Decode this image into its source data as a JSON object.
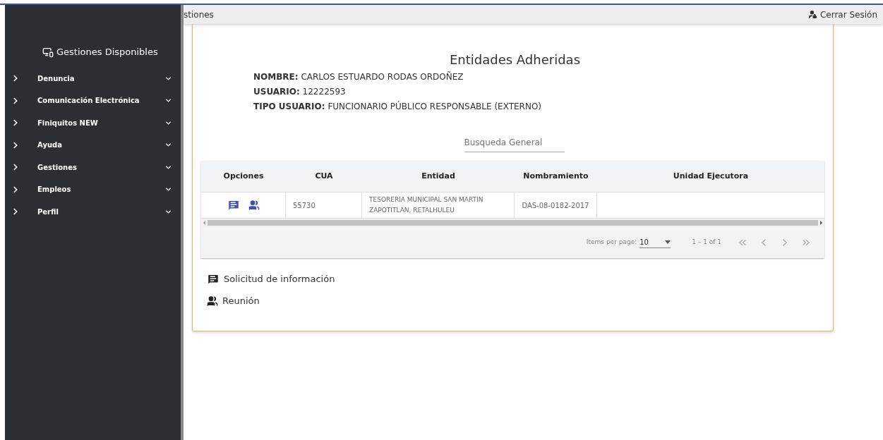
{
  "sidebar": {
    "title": "Gestiones Disponibles",
    "items": [
      {
        "label": "Denuncia",
        "expanded": false
      },
      {
        "label": "Comunicación Electrónica",
        "expanded": false
      },
      {
        "label": "Finiquitos NEW",
        "expanded": false
      },
      {
        "label": "Ayuda",
        "expanded": false
      },
      {
        "label": "Gestiones",
        "expanded": false
      },
      {
        "label": "Empleos",
        "expanded": false
      },
      {
        "label": "Perfil",
        "expanded": false
      }
    ]
  },
  "topbar": {
    "title": "stiones",
    "logout": "Cerrar Sesión"
  },
  "header": {
    "title": "Entidades Adheridas",
    "fields": [
      {
        "label": "NOMBRE:",
        "value": "CARLOS ESTUARDO RODAS ORDOÑEZ"
      },
      {
        "label": "USUARIO:",
        "value": "12222593"
      },
      {
        "label": "TIPO USUARIO:",
        "value": "FUNCIONARIO PÚBLICO RESPONSABLE (EXTERNO)"
      }
    ]
  },
  "search": {
    "placeholder": "Busqueda General"
  },
  "table": {
    "columns": [
      "Opciones",
      "CUA",
      "Entidad",
      "Nombramiento",
      "Unidad Ejecutora"
    ],
    "rows": [
      {
        "cua": "55730",
        "entidad": "TESORERIA MUNICIPAL SAN MARTIN ZAPOTITLAN, RETALHULEU",
        "nombramiento": "DAS-08-0182-2017",
        "unidad": ""
      }
    ]
  },
  "paginator": {
    "label": "Items per page:",
    "page_size": "10",
    "range": "1 – 1 of 1"
  },
  "legend": [
    {
      "kind": "message",
      "label": "Solicitud de información"
    },
    {
      "kind": "people",
      "label": "Reunión"
    }
  ]
}
